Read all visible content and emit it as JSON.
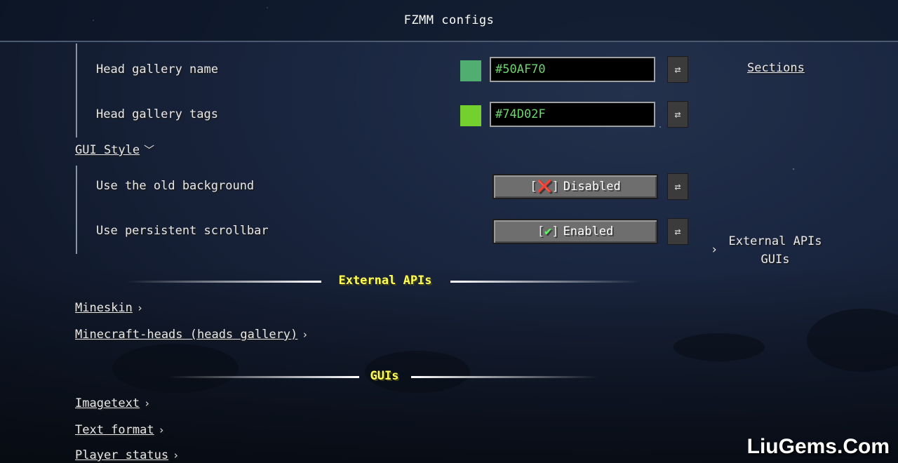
{
  "window": {
    "title": "FZMM configs"
  },
  "settings": {
    "head_gallery_name": {
      "label": "Head gallery name",
      "value": "#50AF70",
      "color": "#50AF70"
    },
    "head_gallery_tags": {
      "label": "Head gallery tags",
      "value": "#74D02F",
      "color": "#74D02F"
    },
    "gui_style_header": "GUI Style",
    "old_background": {
      "label": "Use the old background",
      "box": "❌",
      "state": "Disabled"
    },
    "persistent_scrollbar": {
      "label": "Use persistent scrollbar",
      "box": "✔",
      "state": "Enabled"
    },
    "reset_icon": "⇄"
  },
  "sections": {
    "external_apis": {
      "title": "External APIs",
      "links": [
        "Mineskin",
        "Minecraft-heads (heads gallery)"
      ]
    },
    "guis": {
      "title": "GUIs",
      "links": [
        "Imagetext",
        "Text format",
        "Player status"
      ]
    }
  },
  "sidebar": {
    "header": "Sections",
    "chevron": "›",
    "item_line1": "External APIs",
    "item_line2": "GUIs"
  },
  "watermark": "LiuGems.Com",
  "colors": {
    "divider_title": "#ffff55",
    "hex_text": "#6fd36f"
  }
}
